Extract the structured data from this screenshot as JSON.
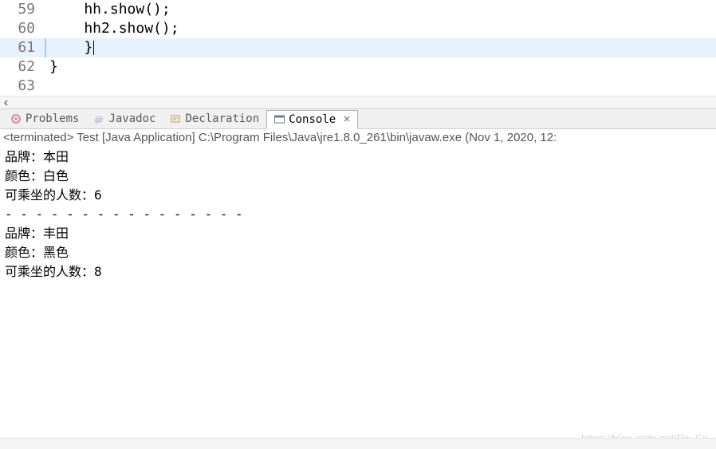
{
  "editor": {
    "lines": [
      {
        "num": "59",
        "text": "    hh.show();",
        "hl": false
      },
      {
        "num": "60",
        "text": "    hh2.show();",
        "hl": false
      },
      {
        "num": "61",
        "text": "    }",
        "hl": true
      },
      {
        "num": "62",
        "text": "}",
        "hl": false
      },
      {
        "num": "63",
        "text": "",
        "hl": false
      }
    ]
  },
  "tabs": {
    "problems": "Problems",
    "javadoc": "Javadoc",
    "declaration": "Declaration",
    "console": "Console"
  },
  "console": {
    "status": "<terminated> Test [Java Application] C:\\Program Files\\Java\\jre1.8.0_261\\bin\\javaw.exe (Nov 1, 2020, 12:",
    "output": [
      "品牌：本田",
      "颜色：白色",
      "可乘坐的人数：6",
      "- - - - - - - - - - - - - - - -",
      "品牌：丰田",
      "颜色：黑色",
      "可乘坐的人数：8"
    ]
  },
  "watermark": "https://blog.csdn.net/Bo_Sir"
}
